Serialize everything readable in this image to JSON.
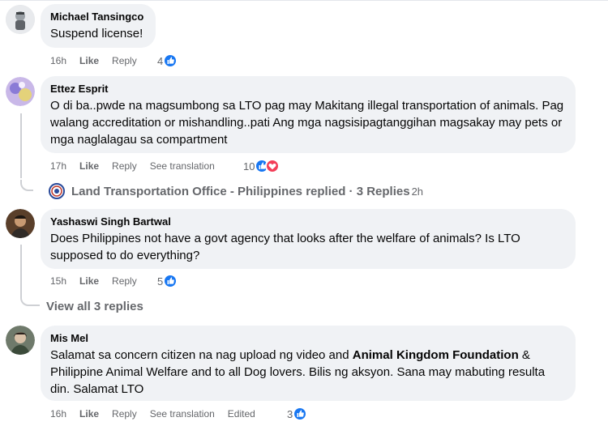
{
  "comments": [
    {
      "author": "Michael Tansingco",
      "text": "Suspend license!",
      "time": "16h",
      "like": "Like",
      "reply": "Reply",
      "reaction_count": "4",
      "avatar_color": "#9aa0a6"
    },
    {
      "author": "Ettez Esprit",
      "text": "O di ba..pwde na magsumbong sa LTO pag may Makitang illegal transportation of animals. Pag walang accreditation or mishandling..pati Ang mga nagsisipagtanggihan magsakay may pets or mga naglalagau sa compartment",
      "time": "17h",
      "like": "Like",
      "reply": "Reply",
      "see_translation": "See translation",
      "reaction_count": "10",
      "avatar_color": "#8a7bd6"
    },
    {
      "author": "Yashaswi Singh Bartwal",
      "text": "Does Philippines not have a govt agency that looks after the welfare of animals? Is LTO supposed to do everything?",
      "time": "15h",
      "like": "Like",
      "reply": "Reply",
      "reaction_count": "5",
      "avatar_color": "#7a5a3a"
    },
    {
      "author": "Mis Mel",
      "text_before": "Salamat sa concern citizen na nag upload ng video and ",
      "text_bold": "Animal Kingdom Foundation",
      "text_after": " & Philippine Animal Welfare and to all Dog lovers. Bilis ng aksyon. Sana may mabuting resulta din. Salamat LTO",
      "time": "16h",
      "like": "Like",
      "reply": "Reply",
      "see_translation": "See translation",
      "edited": "Edited",
      "reaction_count": "3",
      "avatar_color": "#5b6b5a"
    }
  ],
  "replied_summary": {
    "text": "Land Transportation Office - Philippines replied · 3 Replies",
    "time": "2h"
  },
  "view_all": "View all 3 replies",
  "colors": {
    "bubble": "#f0f2f5",
    "like_blue": "#1877f2",
    "love_red": "#f33e58",
    "meta_gray": "#65676b"
  }
}
